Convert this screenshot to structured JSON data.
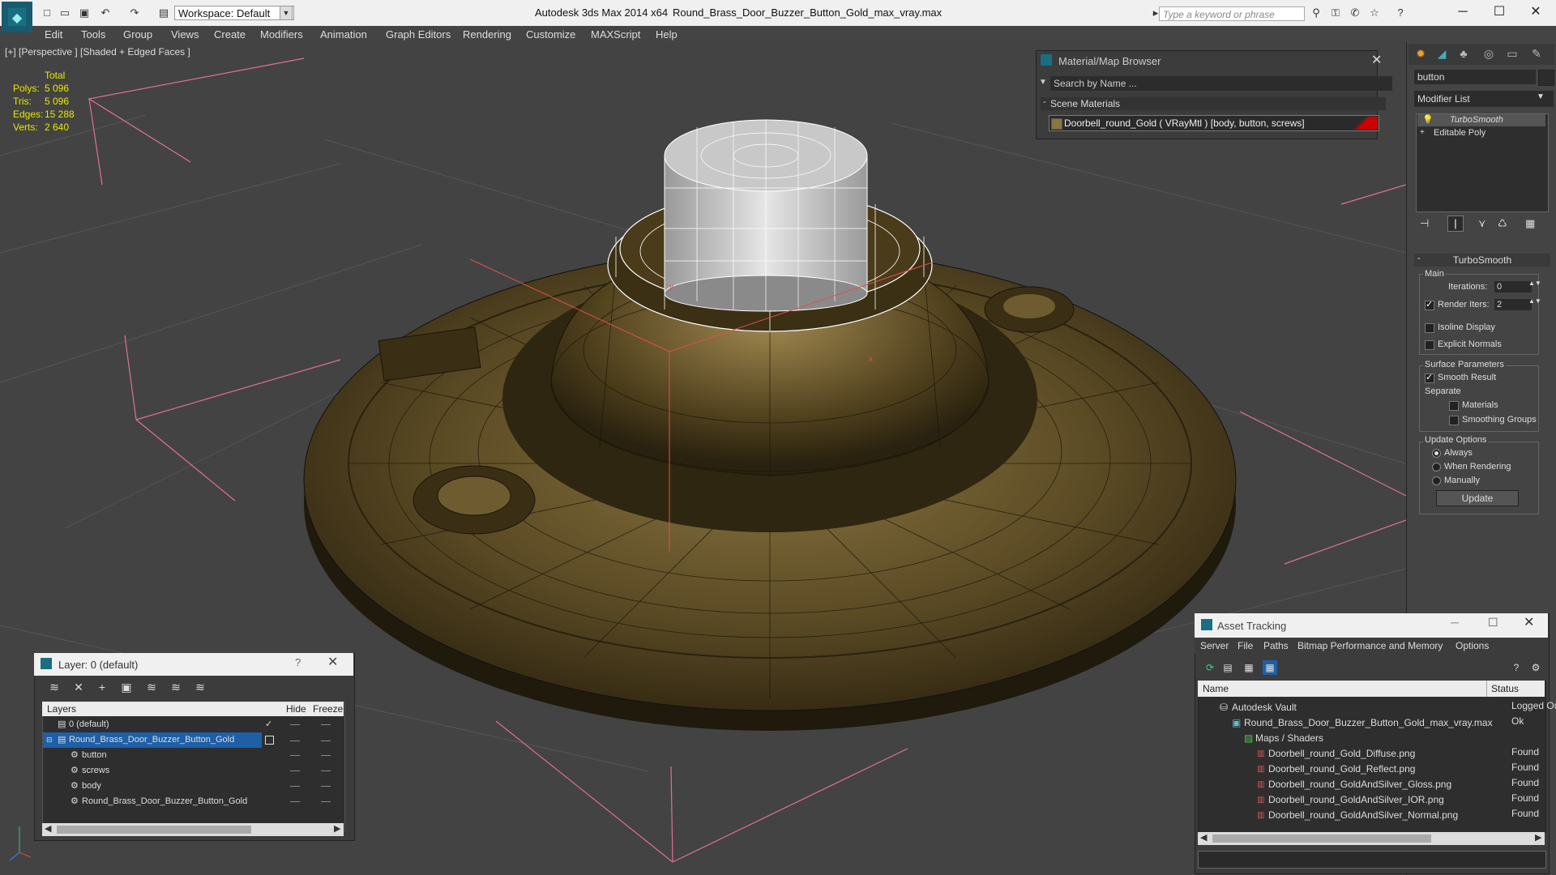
{
  "titlebar": {
    "app_title": "Autodesk 3ds Max  2014 x64",
    "file_title": "Round_Brass_Door_Buzzer_Button_Gold_max_vray.max",
    "workspace": "Workspace: Default",
    "search_placeholder": "Type a keyword or phrase"
  },
  "menubar": [
    "Edit",
    "Tools",
    "Group",
    "Views",
    "Create",
    "Modifiers",
    "Animation",
    "Graph Editors",
    "Rendering",
    "Customize",
    "MAXScript",
    "Help"
  ],
  "viewport": {
    "label": "[+] [Perspective ] [Shaded + Edged Faces ]",
    "stats_header": "Total",
    "stats": [
      {
        "label": "Polys:",
        "value": "5 096"
      },
      {
        "label": "Tris:",
        "value": "5 096"
      },
      {
        "label": "Edges:",
        "value": "15 288"
      },
      {
        "label": "Verts:",
        "value": "2 640"
      }
    ]
  },
  "material_browser": {
    "title": "Material/Map Browser",
    "search_placeholder": "Search by Name ...",
    "section": "Scene Materials",
    "item": "Doorbell_round_Gold  ( VRayMtl ) [body, button, screws]"
  },
  "command_panel": {
    "object_name": "button",
    "modifier_list": "Modifier List",
    "stack": [
      "TurboSmooth",
      "Editable Poly"
    ],
    "rollout_title": "TurboSmooth",
    "main_group": "Main",
    "iterations_label": "Iterations:",
    "iterations_value": "0",
    "render_iters_label": "Render Iters:",
    "render_iters_value": "2",
    "isoline_display": "Isoline Display",
    "explicit_normals": "Explicit Normals",
    "surface_parameters": "Surface Parameters",
    "smooth_result": "Smooth Result",
    "separate": "Separate",
    "materials": "Materials",
    "smoothing_groups": "Smoothing Groups",
    "update_options": "Update Options",
    "always": "Always",
    "when_rendering": "When Rendering",
    "manually": "Manually",
    "update_button": "Update"
  },
  "layer_panel": {
    "title": "Layer: 0 (default)",
    "help": "?",
    "col_layers": "Layers",
    "col_hide": "Hide",
    "col_freeze": "Freeze",
    "rows": [
      {
        "name": "0 (default)"
      },
      {
        "name": "Round_Brass_Door_Buzzer_Button_Gold"
      },
      {
        "name": "button"
      },
      {
        "name": "screws"
      },
      {
        "name": "body"
      },
      {
        "name": "Round_Brass_Door_Buzzer_Button_Gold"
      }
    ]
  },
  "asset_tracking": {
    "title": "Asset Tracking",
    "menus": [
      "Server",
      "File",
      "Paths",
      "Bitmap Performance and Memory",
      "Options"
    ],
    "col_name": "Name",
    "col_status": "Status",
    "rows": [
      {
        "name": "Autodesk Vault",
        "status": "Logged Ou"
      },
      {
        "name": "Round_Brass_Door_Buzzer_Button_Gold_max_vray.max",
        "status": "Ok"
      },
      {
        "name": "Maps / Shaders",
        "status": ""
      },
      {
        "name": "Doorbell_round_Gold_Diffuse.png",
        "status": "Found"
      },
      {
        "name": "Doorbell_round_Gold_Reflect.png",
        "status": "Found"
      },
      {
        "name": "Doorbell_round_GoldAndSilver_Gloss.png",
        "status": "Found"
      },
      {
        "name": "Doorbell_round_GoldAndSilver_IOR.png",
        "status": "Found"
      },
      {
        "name": "Doorbell_round_GoldAndSilver_Normal.png",
        "status": "Found"
      }
    ]
  }
}
